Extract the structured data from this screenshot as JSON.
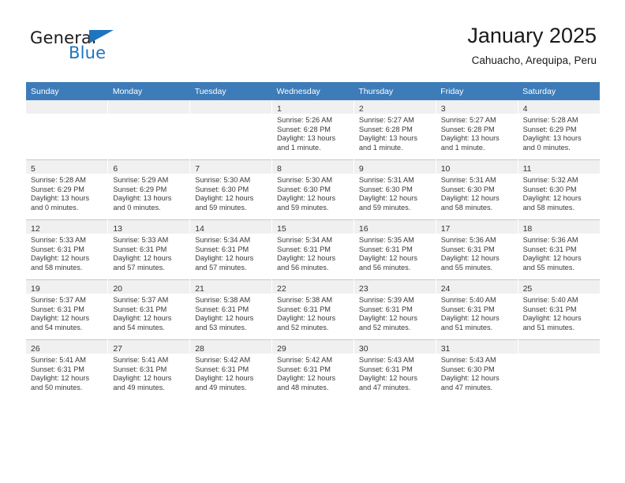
{
  "brand": {
    "word_one": "General",
    "word_two": "Blue",
    "accent_color": "#1d75bd"
  },
  "header": {
    "month_title": "January 2025",
    "location": "Cahuacho, Arequipa, Peru"
  },
  "calendar": {
    "header_color": "#3d7cb8",
    "weekday_headers": [
      "Sunday",
      "Monday",
      "Tuesday",
      "Wednesday",
      "Thursday",
      "Friday",
      "Saturday"
    ],
    "weeks": [
      [
        {
          "day": "",
          "lines": []
        },
        {
          "day": "",
          "lines": []
        },
        {
          "day": "",
          "lines": []
        },
        {
          "day": "1",
          "lines": [
            "Sunrise: 5:26 AM",
            "Sunset: 6:28 PM",
            "Daylight: 13 hours",
            "and 1 minute."
          ]
        },
        {
          "day": "2",
          "lines": [
            "Sunrise: 5:27 AM",
            "Sunset: 6:28 PM",
            "Daylight: 13 hours",
            "and 1 minute."
          ]
        },
        {
          "day": "3",
          "lines": [
            "Sunrise: 5:27 AM",
            "Sunset: 6:28 PM",
            "Daylight: 13 hours",
            "and 1 minute."
          ]
        },
        {
          "day": "4",
          "lines": [
            "Sunrise: 5:28 AM",
            "Sunset: 6:29 PM",
            "Daylight: 13 hours",
            "and 0 minutes."
          ]
        }
      ],
      [
        {
          "day": "5",
          "lines": [
            "Sunrise: 5:28 AM",
            "Sunset: 6:29 PM",
            "Daylight: 13 hours",
            "and 0 minutes."
          ]
        },
        {
          "day": "6",
          "lines": [
            "Sunrise: 5:29 AM",
            "Sunset: 6:29 PM",
            "Daylight: 13 hours",
            "and 0 minutes."
          ]
        },
        {
          "day": "7",
          "lines": [
            "Sunrise: 5:30 AM",
            "Sunset: 6:30 PM",
            "Daylight: 12 hours",
            "and 59 minutes."
          ]
        },
        {
          "day": "8",
          "lines": [
            "Sunrise: 5:30 AM",
            "Sunset: 6:30 PM",
            "Daylight: 12 hours",
            "and 59 minutes."
          ]
        },
        {
          "day": "9",
          "lines": [
            "Sunrise: 5:31 AM",
            "Sunset: 6:30 PM",
            "Daylight: 12 hours",
            "and 59 minutes."
          ]
        },
        {
          "day": "10",
          "lines": [
            "Sunrise: 5:31 AM",
            "Sunset: 6:30 PM",
            "Daylight: 12 hours",
            "and 58 minutes."
          ]
        },
        {
          "day": "11",
          "lines": [
            "Sunrise: 5:32 AM",
            "Sunset: 6:30 PM",
            "Daylight: 12 hours",
            "and 58 minutes."
          ]
        }
      ],
      [
        {
          "day": "12",
          "lines": [
            "Sunrise: 5:33 AM",
            "Sunset: 6:31 PM",
            "Daylight: 12 hours",
            "and 58 minutes."
          ]
        },
        {
          "day": "13",
          "lines": [
            "Sunrise: 5:33 AM",
            "Sunset: 6:31 PM",
            "Daylight: 12 hours",
            "and 57 minutes."
          ]
        },
        {
          "day": "14",
          "lines": [
            "Sunrise: 5:34 AM",
            "Sunset: 6:31 PM",
            "Daylight: 12 hours",
            "and 57 minutes."
          ]
        },
        {
          "day": "15",
          "lines": [
            "Sunrise: 5:34 AM",
            "Sunset: 6:31 PM",
            "Daylight: 12 hours",
            "and 56 minutes."
          ]
        },
        {
          "day": "16",
          "lines": [
            "Sunrise: 5:35 AM",
            "Sunset: 6:31 PM",
            "Daylight: 12 hours",
            "and 56 minutes."
          ]
        },
        {
          "day": "17",
          "lines": [
            "Sunrise: 5:36 AM",
            "Sunset: 6:31 PM",
            "Daylight: 12 hours",
            "and 55 minutes."
          ]
        },
        {
          "day": "18",
          "lines": [
            "Sunrise: 5:36 AM",
            "Sunset: 6:31 PM",
            "Daylight: 12 hours",
            "and 55 minutes."
          ]
        }
      ],
      [
        {
          "day": "19",
          "lines": [
            "Sunrise: 5:37 AM",
            "Sunset: 6:31 PM",
            "Daylight: 12 hours",
            "and 54 minutes."
          ]
        },
        {
          "day": "20",
          "lines": [
            "Sunrise: 5:37 AM",
            "Sunset: 6:31 PM",
            "Daylight: 12 hours",
            "and 54 minutes."
          ]
        },
        {
          "day": "21",
          "lines": [
            "Sunrise: 5:38 AM",
            "Sunset: 6:31 PM",
            "Daylight: 12 hours",
            "and 53 minutes."
          ]
        },
        {
          "day": "22",
          "lines": [
            "Sunrise: 5:38 AM",
            "Sunset: 6:31 PM",
            "Daylight: 12 hours",
            "and 52 minutes."
          ]
        },
        {
          "day": "23",
          "lines": [
            "Sunrise: 5:39 AM",
            "Sunset: 6:31 PM",
            "Daylight: 12 hours",
            "and 52 minutes."
          ]
        },
        {
          "day": "24",
          "lines": [
            "Sunrise: 5:40 AM",
            "Sunset: 6:31 PM",
            "Daylight: 12 hours",
            "and 51 minutes."
          ]
        },
        {
          "day": "25",
          "lines": [
            "Sunrise: 5:40 AM",
            "Sunset: 6:31 PM",
            "Daylight: 12 hours",
            "and 51 minutes."
          ]
        }
      ],
      [
        {
          "day": "26",
          "lines": [
            "Sunrise: 5:41 AM",
            "Sunset: 6:31 PM",
            "Daylight: 12 hours",
            "and 50 minutes."
          ]
        },
        {
          "day": "27",
          "lines": [
            "Sunrise: 5:41 AM",
            "Sunset: 6:31 PM",
            "Daylight: 12 hours",
            "and 49 minutes."
          ]
        },
        {
          "day": "28",
          "lines": [
            "Sunrise: 5:42 AM",
            "Sunset: 6:31 PM",
            "Daylight: 12 hours",
            "and 49 minutes."
          ]
        },
        {
          "day": "29",
          "lines": [
            "Sunrise: 5:42 AM",
            "Sunset: 6:31 PM",
            "Daylight: 12 hours",
            "and 48 minutes."
          ]
        },
        {
          "day": "30",
          "lines": [
            "Sunrise: 5:43 AM",
            "Sunset: 6:31 PM",
            "Daylight: 12 hours",
            "and 47 minutes."
          ]
        },
        {
          "day": "31",
          "lines": [
            "Sunrise: 5:43 AM",
            "Sunset: 6:30 PM",
            "Daylight: 12 hours",
            "and 47 minutes."
          ]
        },
        {
          "day": "",
          "lines": []
        }
      ]
    ]
  }
}
